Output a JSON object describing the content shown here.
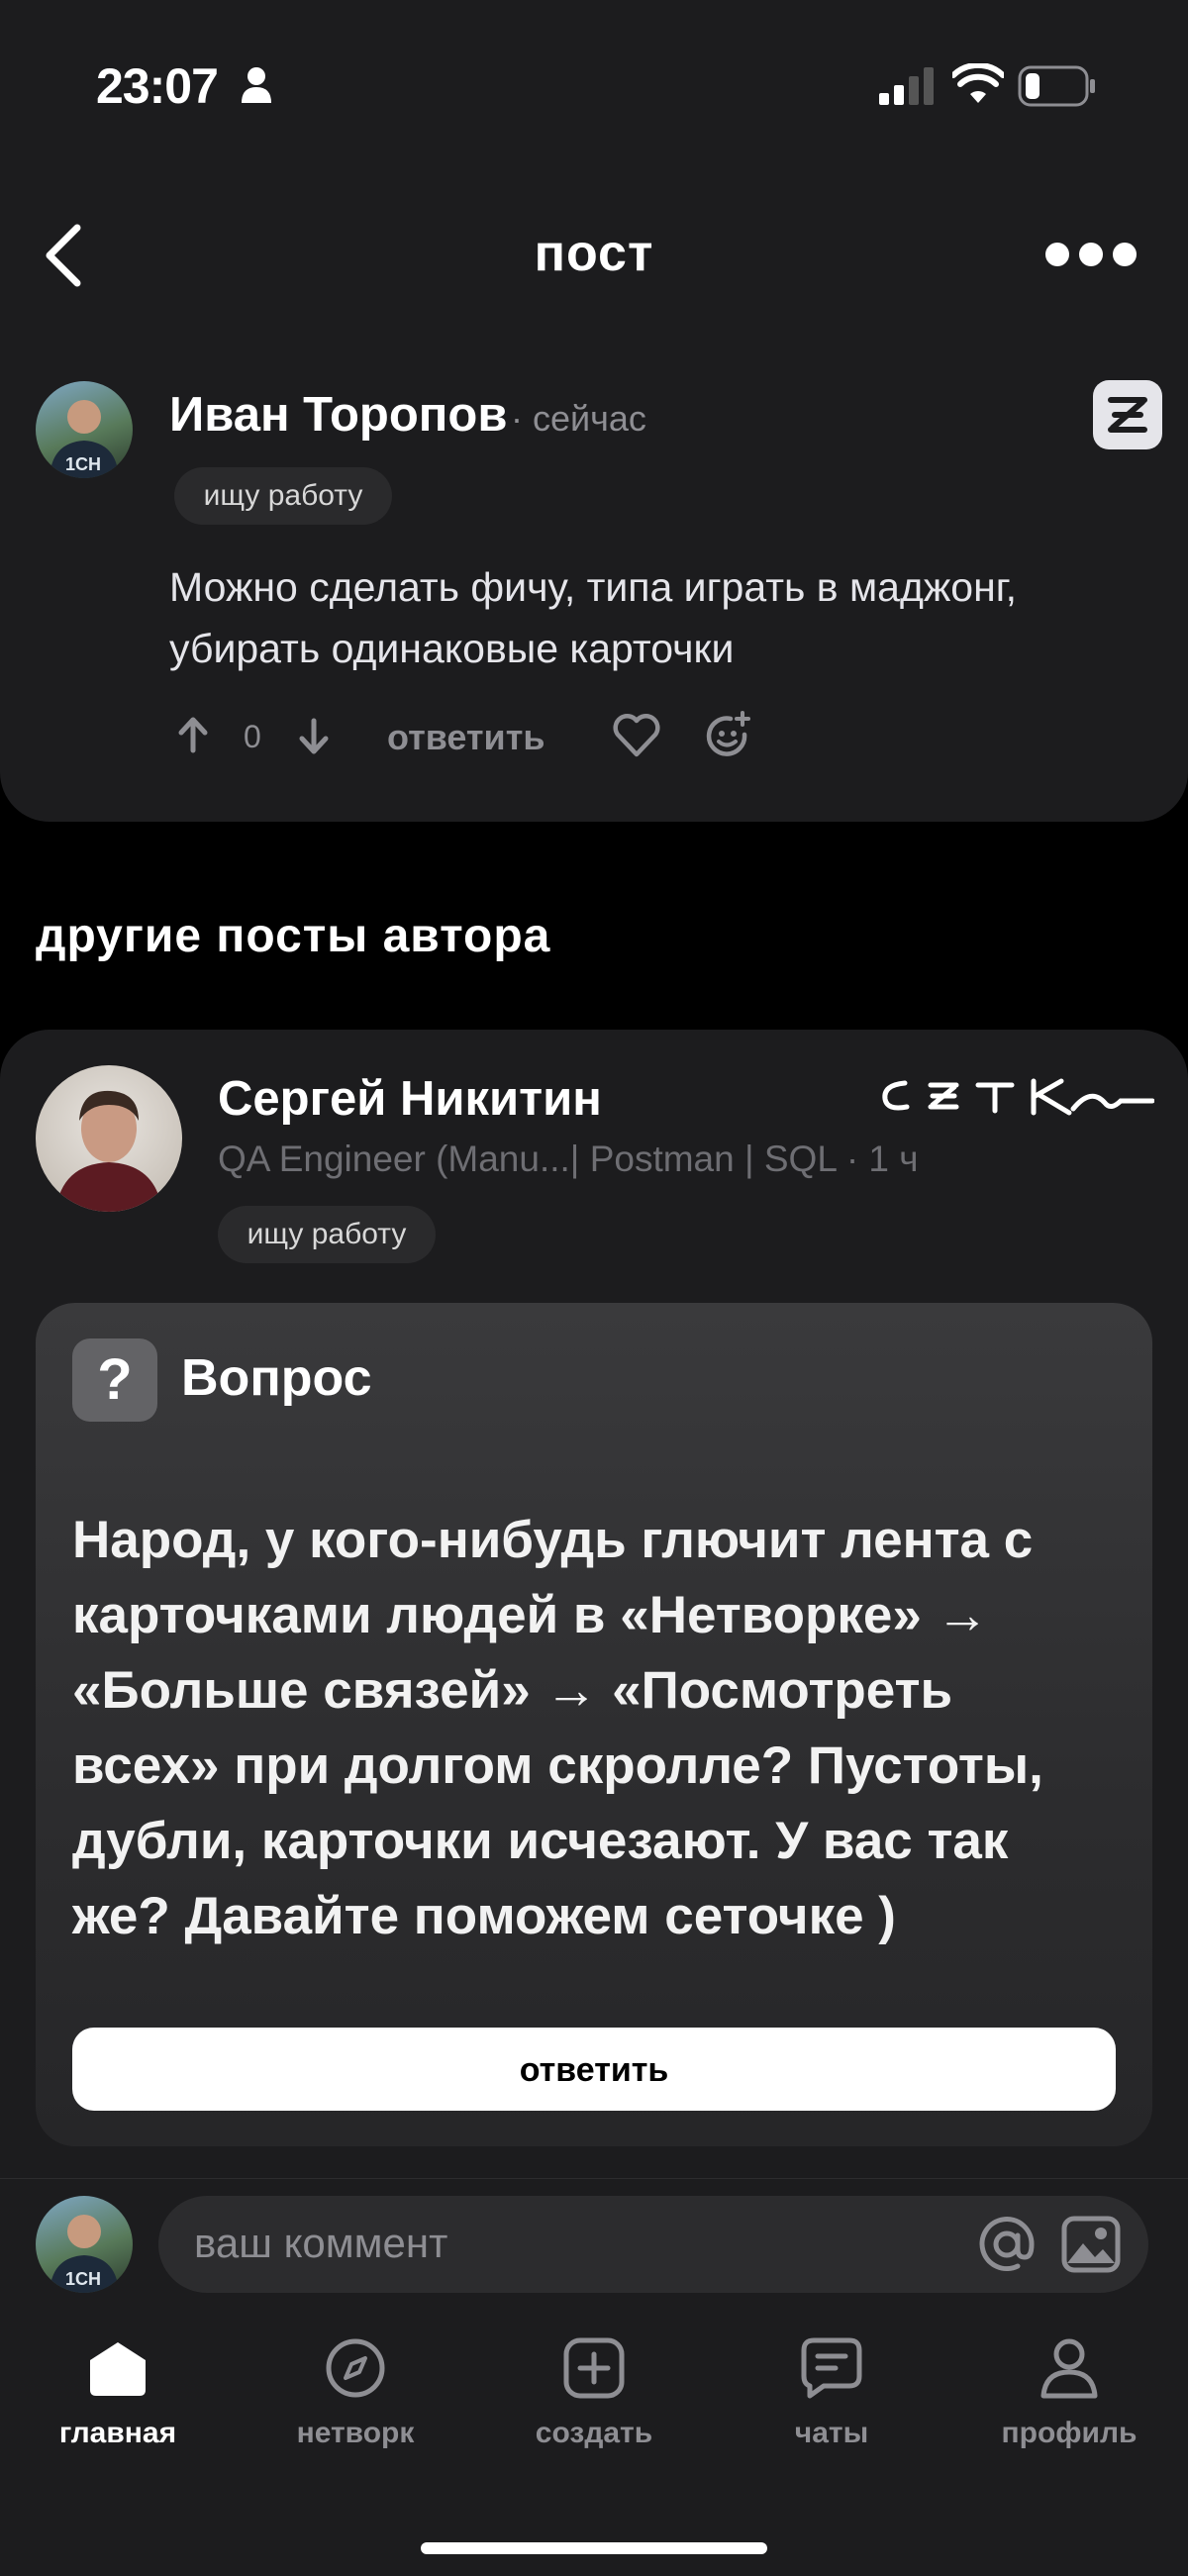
{
  "status_bar": {
    "time": "23:07"
  },
  "header": {
    "title": "пост"
  },
  "comment": {
    "author": "Иван Торопов",
    "time": "· сейчас",
    "tag": "ищу работу",
    "text_line1": "Можно сделать фичу, типа играть в маджонг,",
    "text_line2": "убирать одинаковые карточки",
    "score": "0",
    "reply_label": "ответить"
  },
  "section": {
    "title": "другие посты автора"
  },
  "post": {
    "author": "Сергей Никитин",
    "subtitle": "QA Engineer (Manu...| Postman | SQL · 1 ч",
    "brand": "СЕТКА",
    "tag": "ищу работу",
    "question_label": "Вопрос",
    "question_lines": [
      "Народ, у кого-нибудь глючит лента с",
      "карточками людей в «Нетворке» →",
      "«Больше связей» → «Посмотреть",
      "всех» при долгом скролле? Пустоты,",
      "дубли, карточки исчезают. У вас так",
      "же? Давайте поможем сеточке )"
    ],
    "reply_button": "ответить"
  },
  "comment_input": {
    "placeholder": "ваш коммент"
  },
  "tabs": [
    {
      "label": "главная",
      "icon": "home-icon",
      "active": true
    },
    {
      "label": "нетворк",
      "icon": "compass-icon",
      "active": false
    },
    {
      "label": "создать",
      "icon": "plus-square-icon",
      "active": false
    },
    {
      "label": "чаты",
      "icon": "chat-icon",
      "active": false
    },
    {
      "label": "профиль",
      "icon": "person-icon",
      "active": false
    }
  ],
  "colors": {
    "background": "#000000",
    "card": "#1c1c1e",
    "muted": "#8e8e93"
  }
}
